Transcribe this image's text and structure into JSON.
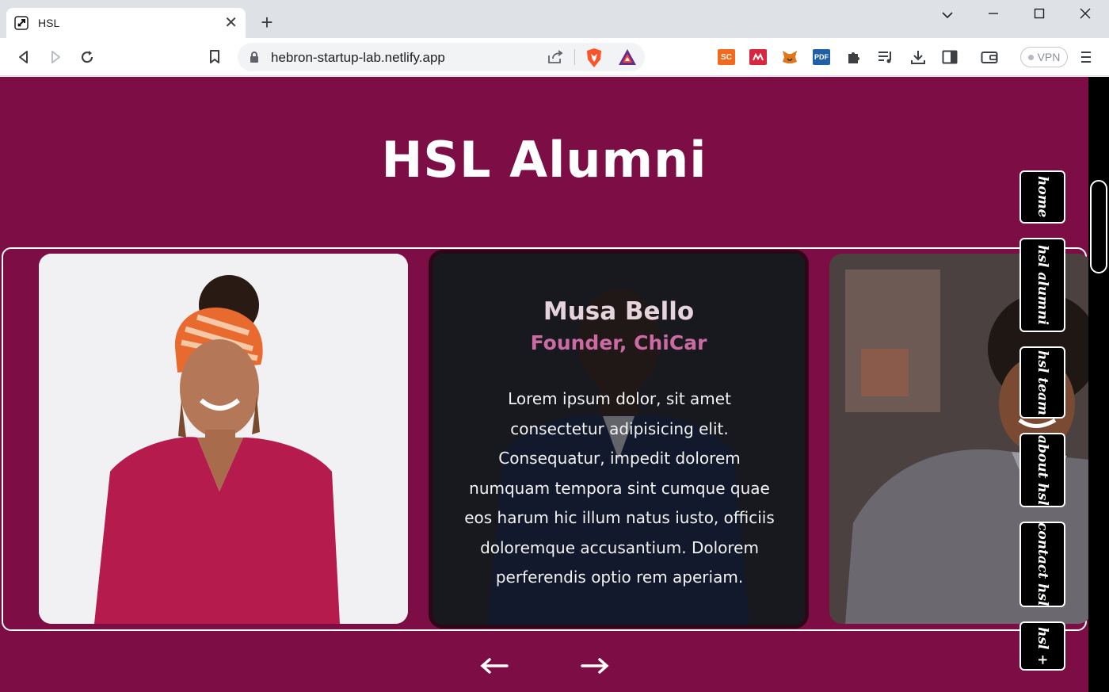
{
  "browser": {
    "tab_title": "HSL",
    "url": "hebron-startup-lab.netlify.app",
    "vpn_label": "VPN",
    "extensions": [
      {
        "name": "sc-extension",
        "label": "SC",
        "color": "#f26b1d"
      },
      {
        "name": "mendeley-extension",
        "label": "",
        "color": "#d7263d"
      },
      {
        "name": "metamask-extension",
        "label": "",
        "color": "#e2761b"
      },
      {
        "name": "pdf-extension",
        "label": "PDF",
        "color": "#1f5fa8"
      }
    ]
  },
  "page": {
    "title": "HSL Alumni",
    "background": "#7d0d45",
    "carousel": {
      "active": {
        "name": "Musa Bello",
        "role": "Founder, ChiCar",
        "bio": "Lorem ipsum dolor, sit amet consectetur adipisicing elit. Consequatur, impedit dolorem numquam tempora sint cumque quae eos harum hic illum natus iusto, officiis doloremque accusantium. Dolorem perferendis optio rem aperiam."
      }
    },
    "side_nav": [
      {
        "label": "home"
      },
      {
        "label": "hsl alumni"
      },
      {
        "label": "hsl team"
      },
      {
        "label": "about hsl"
      },
      {
        "label": "contact hsl"
      },
      {
        "label": "hsl +"
      }
    ]
  }
}
